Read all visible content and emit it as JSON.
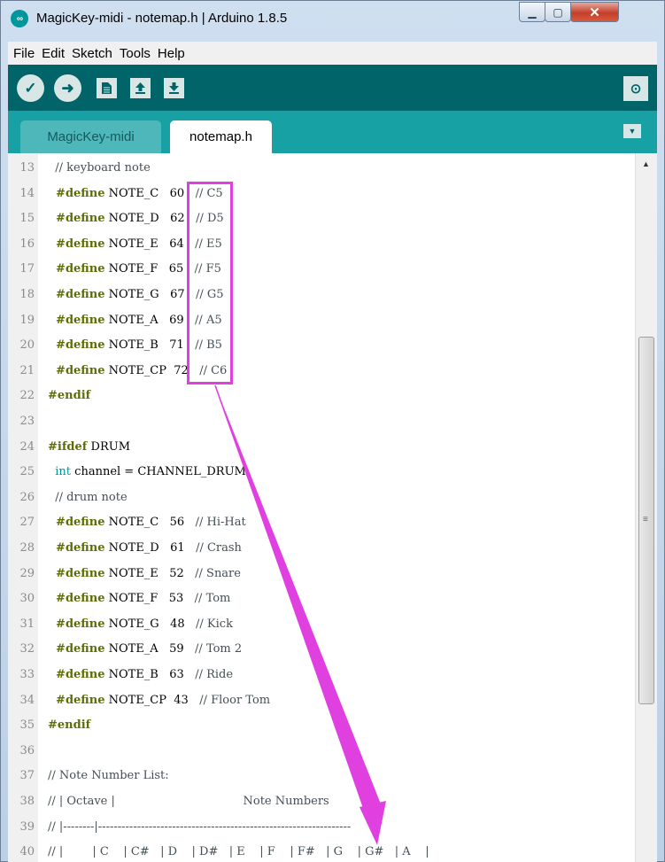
{
  "window": {
    "title": "MagicKey-midi - notemap.h | Arduino 1.8.5",
    "icon_text": "∞"
  },
  "menu": [
    {
      "label": "File"
    },
    {
      "label": "Edit"
    },
    {
      "label": "Sketch"
    },
    {
      "label": "Tools"
    },
    {
      "label": "Help"
    }
  ],
  "toolbar": [
    "verify-icon",
    "upload-icon",
    "new-icon",
    "open-icon",
    "save-icon",
    "serial-monitor-icon"
  ],
  "tabs": [
    {
      "label": "MagicKey-midi",
      "active": false
    },
    {
      "label": "notemap.h",
      "active": true
    }
  ],
  "code_lines": [
    {
      "n": "13",
      "segs": [
        [
          "cm",
          "  // keyboard note"
        ]
      ]
    },
    {
      "n": "14",
      "segs": [
        [
          "kw",
          "  #define"
        ],
        [
          "",
          " NOTE_C   60   "
        ],
        [
          "cm",
          "// C5"
        ]
      ]
    },
    {
      "n": "15",
      "segs": [
        [
          "kw",
          "  #define"
        ],
        [
          "",
          " NOTE_D   62   "
        ],
        [
          "cm",
          "// D5"
        ]
      ]
    },
    {
      "n": "16",
      "segs": [
        [
          "kw",
          "  #define"
        ],
        [
          "",
          " NOTE_E   64   "
        ],
        [
          "cm",
          "// E5"
        ]
      ]
    },
    {
      "n": "17",
      "segs": [
        [
          "kw",
          "  #define"
        ],
        [
          "",
          " NOTE_F   65   "
        ],
        [
          "cm",
          "// F5"
        ]
      ]
    },
    {
      "n": "18",
      "segs": [
        [
          "kw",
          "  #define"
        ],
        [
          "",
          " NOTE_G   67   "
        ],
        [
          "cm",
          "// G5"
        ]
      ]
    },
    {
      "n": "19",
      "segs": [
        [
          "kw",
          "  #define"
        ],
        [
          "",
          " NOTE_A   69   "
        ],
        [
          "cm",
          "// A5"
        ]
      ]
    },
    {
      "n": "20",
      "segs": [
        [
          "kw",
          "  #define"
        ],
        [
          "",
          " NOTE_B   71   "
        ],
        [
          "cm",
          "// B5"
        ]
      ]
    },
    {
      "n": "21",
      "segs": [
        [
          "kw",
          "  #define"
        ],
        [
          "",
          " NOTE_CP  72   "
        ],
        [
          "cm",
          "// C6"
        ]
      ]
    },
    {
      "n": "22",
      "segs": [
        [
          "kw",
          "#endif"
        ]
      ]
    },
    {
      "n": "23",
      "segs": [
        [
          "",
          ""
        ]
      ]
    },
    {
      "n": "24",
      "segs": [
        [
          "kw",
          "#ifdef"
        ],
        [
          "",
          " DRUM"
        ]
      ]
    },
    {
      "n": "25",
      "segs": [
        [
          "ty",
          "  int"
        ],
        [
          "",
          " channel = CHANNEL_DRUM;"
        ]
      ]
    },
    {
      "n": "26",
      "segs": [
        [
          "cm",
          "  // drum note"
        ]
      ]
    },
    {
      "n": "27",
      "segs": [
        [
          "kw",
          "  #define"
        ],
        [
          "",
          " NOTE_C   56   "
        ],
        [
          "cm",
          "// Hi-Hat"
        ]
      ]
    },
    {
      "n": "28",
      "segs": [
        [
          "kw",
          "  #define"
        ],
        [
          "",
          " NOTE_D   61   "
        ],
        [
          "cm",
          "// Crash"
        ]
      ]
    },
    {
      "n": "29",
      "segs": [
        [
          "kw",
          "  #define"
        ],
        [
          "",
          " NOTE_E   52   "
        ],
        [
          "cm",
          "// Snare"
        ]
      ]
    },
    {
      "n": "30",
      "segs": [
        [
          "kw",
          "  #define"
        ],
        [
          "",
          " NOTE_F   53   "
        ],
        [
          "cm",
          "// Tom"
        ]
      ]
    },
    {
      "n": "31",
      "segs": [
        [
          "kw",
          "  #define"
        ],
        [
          "",
          " NOTE_G   48   "
        ],
        [
          "cm",
          "// Kick"
        ]
      ]
    },
    {
      "n": "32",
      "segs": [
        [
          "kw",
          "  #define"
        ],
        [
          "",
          " NOTE_A   59   "
        ],
        [
          "cm",
          "// Tom 2"
        ]
      ]
    },
    {
      "n": "33",
      "segs": [
        [
          "kw",
          "  #define"
        ],
        [
          "",
          " NOTE_B   63   "
        ],
        [
          "cm",
          "// Ride"
        ]
      ]
    },
    {
      "n": "34",
      "segs": [
        [
          "kw",
          "  #define"
        ],
        [
          "",
          " NOTE_CP  43   "
        ],
        [
          "cm",
          "// Floor Tom"
        ]
      ]
    },
    {
      "n": "35",
      "segs": [
        [
          "kw",
          "#endif"
        ]
      ]
    },
    {
      "n": "36",
      "segs": [
        [
          "",
          ""
        ]
      ]
    },
    {
      "n": "37",
      "segs": [
        [
          "cm",
          "// Note Number List:"
        ]
      ]
    },
    {
      "n": "38",
      "segs": [
        [
          "cm",
          "// | Octave |                                   Note Numbers"
        ]
      ]
    },
    {
      "n": "39",
      "segs": [
        [
          "cm",
          "// |--------|-----------------------------------------------------------------"
        ]
      ]
    },
    {
      "n": "40",
      "segs": [
        [
          "cm",
          "// |        | C    | C#   | D    | D#   | E    | F    | F#   | G    | G#   | A    |"
        ]
      ]
    }
  ],
  "colors": {
    "toolbar": "#006468",
    "tabbar": "#17a1a5",
    "highlight": "#e040e0",
    "keyword": "#5e6d03",
    "type": "#00979c"
  }
}
